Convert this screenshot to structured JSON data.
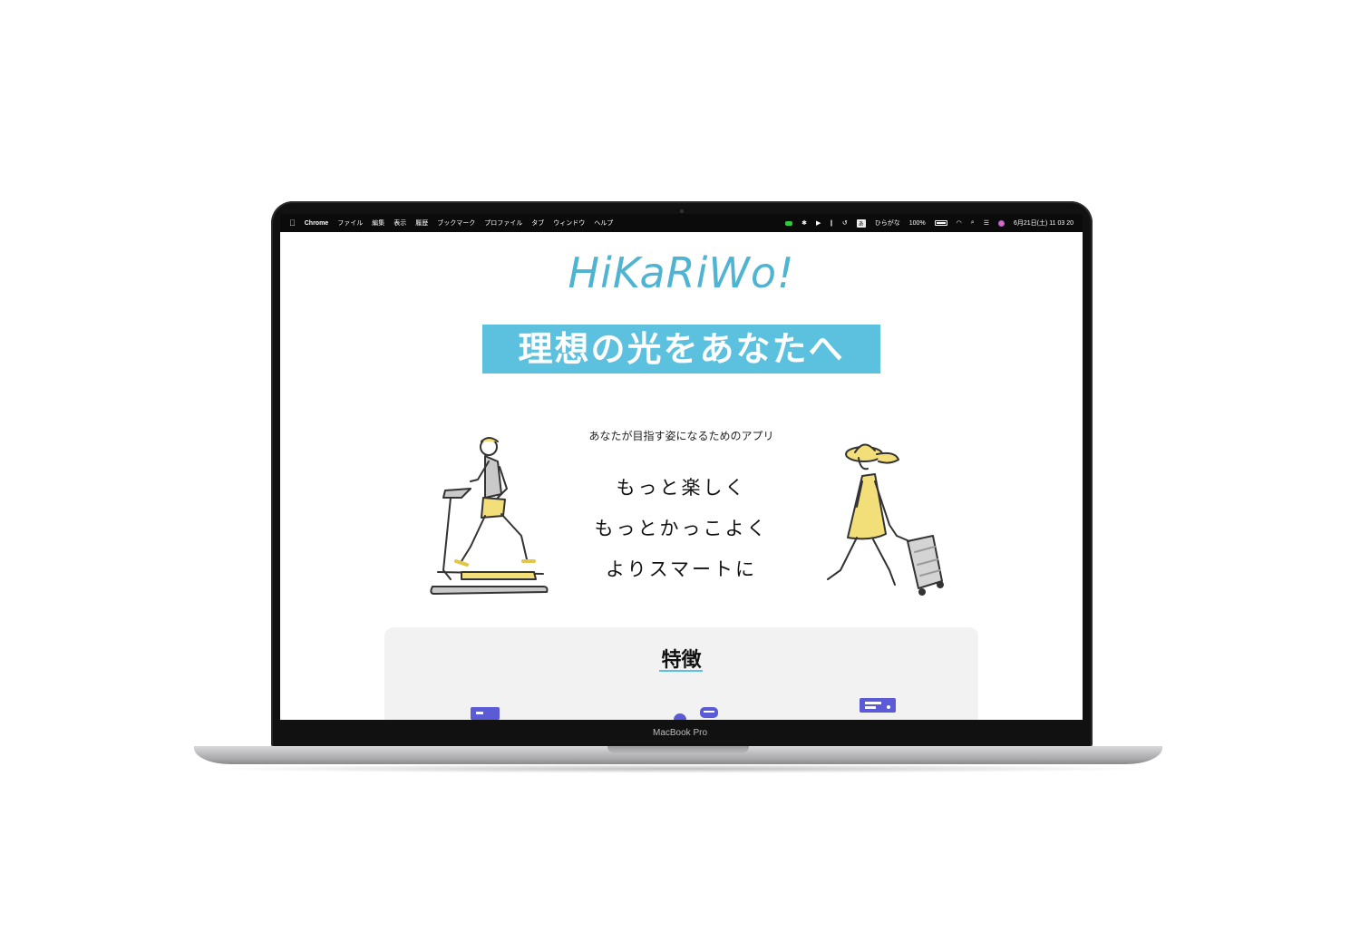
{
  "device": {
    "label": "MacBook Pro"
  },
  "menubar": {
    "app_name": "Chrome",
    "menus": [
      "ファイル",
      "編集",
      "表示",
      "履歴",
      "ブックマーク",
      "プロファイル",
      "タブ",
      "ウィンドウ",
      "ヘルプ"
    ],
    "input_source_badge": "あ",
    "input_source_label": "ひらがな",
    "battery_percent": "100%",
    "datetime": "6月21日(土)  11 03 20"
  },
  "page": {
    "logo": "HiKaRiWo!",
    "hero": "理想の光をあなたへ",
    "subtitle": "あなたが目指す姿になるためのアプリ",
    "taglines": [
      "もっと楽しく",
      "もっとかっこよく",
      "よりスマートに"
    ],
    "features_title": "特徴"
  },
  "colors": {
    "brand": "#5bc1de",
    "logo": "#4fb3d2",
    "illustration_accent": "#f2df7a",
    "feature_icon": "#5b5bd6"
  }
}
